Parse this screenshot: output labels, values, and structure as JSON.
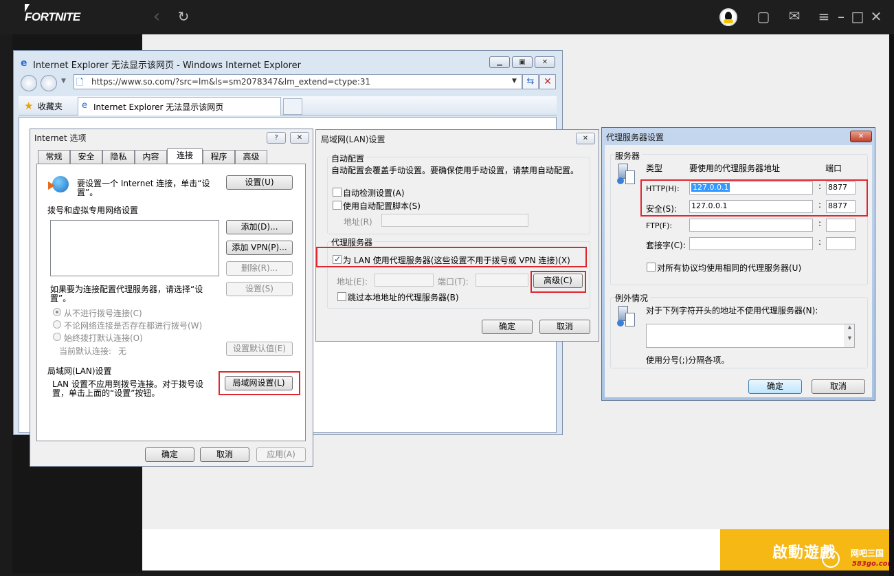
{
  "launcher": {
    "logo": "FORTNITE",
    "back_icon": "‹",
    "refresh_icon": "↻",
    "chat_icon": "▢",
    "mail_icon": "✉",
    "menu_icon": "≡",
    "min_icon": "–",
    "max_icon": "□",
    "close_icon": "✕",
    "play_label": "啟動遊戲",
    "site_badge": "网吧三国",
    "site_url": "583go.com"
  },
  "ie": {
    "title": "Internet Explorer 无法显示该网页 - Windows Internet Explorer",
    "url": "https://www.so.com/?src=lm&ls=sm2078347&lm_extend=ctype:31",
    "favorites_label": "收藏夹",
    "tab_label": "Internet Explorer 无法显示该网页",
    "min": "▁",
    "max": "▣",
    "close": "✕"
  },
  "internet_options": {
    "title": "Internet 选项",
    "help": "?",
    "close": "✕",
    "tabs": [
      "常规",
      "安全",
      "隐私",
      "内容",
      "连接",
      "程序",
      "高级"
    ],
    "setup_text_line1": "要设置一个 Internet 连接，单击“设",
    "setup_text_line2": "置”。",
    "setup_button": "设置(U)",
    "dialup_section": "拨号和虚拟专用网络设置",
    "add_button": "添加(D)...",
    "add_vpn_button": "添加 VPN(P)...",
    "delete_button": "删除(R)...",
    "settings_button": "设置(S)",
    "proxy_hint_line1": "如果要为连接配置代理服务器，请选择“设",
    "proxy_hint_line2": "置”。",
    "radio_never": "从不进行拨号连接(C)",
    "radio_when_no_network": "不论网络连接是否存在都进行拨号(W)",
    "radio_always": "始终拨打默认连接(O)",
    "current_default_label": "当前默认连接:",
    "current_default_value": "无",
    "set_default_button": "设置默认值(E)",
    "lan_section": "局域网(LAN)设置",
    "lan_text_line1": "LAN 设置不应用到拨号连接。对于拨号设",
    "lan_text_line2": "置，单击上面的“设置”按钮。",
    "lan_settings_button": "局域网设置(L)",
    "ok": "确定",
    "cancel": "取消",
    "apply": "应用(A)"
  },
  "lan_settings": {
    "title": "局域网(LAN)设置",
    "close": "✕",
    "auto_config_section": "自动配置",
    "auto_config_desc": "自动配置会覆盖手动设置。要确保使用手动设置，请禁用自动配置。",
    "auto_detect": "自动检测设置(A)",
    "use_script": "使用自动配置脚本(S)",
    "address_label": "地址(R)",
    "proxy_section": "代理服务器",
    "use_proxy": "为 LAN 使用代理服务器(这些设置不用于拨号或 VPN 连接)(X)",
    "proxy_address_label": "地址(E):",
    "proxy_port_label": "端口(T):",
    "advanced_button": "高级(C)",
    "bypass_local": "跳过本地地址的代理服务器(B)",
    "ok": "确定",
    "cancel": "取消"
  },
  "proxy_settings": {
    "title": "代理服务器设置",
    "close": "✕",
    "servers_section": "服务器",
    "col_type": "类型",
    "col_address": "要使用的代理服务器地址",
    "col_port": "端口",
    "rows": [
      {
        "type": "HTTP(H):",
        "address": "127.0.0.1",
        "port": "8877"
      },
      {
        "type": "安全(S):",
        "address": "127.0.0.1",
        "port": "8877"
      },
      {
        "type": "FTP(F):",
        "address": "",
        "port": ""
      },
      {
        "type": "套接字(C):",
        "address": "",
        "port": ""
      }
    ],
    "colon": ":",
    "same_proxy": "对所有协议均使用相同的代理服务器(U)",
    "exceptions_section": "例外情况",
    "exceptions_desc": "对于下列字符开头的地址不使用代理服务器(N):",
    "separator_hint": "使用分号(;)分隔各项。",
    "ok": "确定",
    "cancel": "取消"
  }
}
